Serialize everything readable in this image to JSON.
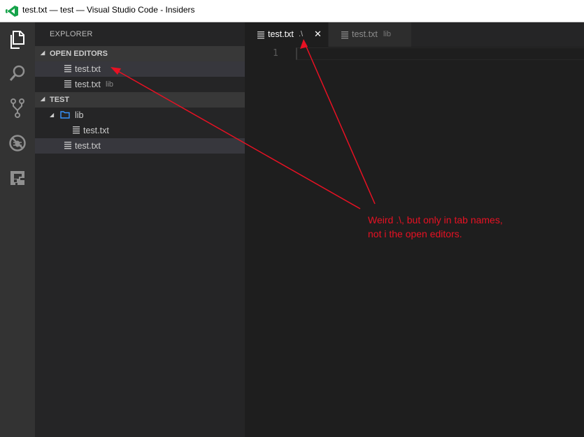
{
  "window": {
    "title": "test.txt — test — Visual Studio Code - Insiders"
  },
  "activity_bar": {
    "items": [
      {
        "name": "explorer",
        "icon": "files-icon",
        "active": true
      },
      {
        "name": "search",
        "icon": "search-icon",
        "active": false
      },
      {
        "name": "source-control",
        "icon": "git-branch-icon",
        "active": false
      },
      {
        "name": "debug",
        "icon": "debug-icon",
        "active": false
      },
      {
        "name": "extensions",
        "icon": "extensions-icon",
        "active": false
      }
    ]
  },
  "sidebar": {
    "title": "EXPLORER",
    "open_editors": {
      "header": "OPEN EDITORS",
      "items": [
        {
          "name": "test.txt",
          "desc": ""
        },
        {
          "name": "test.txt",
          "desc": "lib"
        }
      ]
    },
    "workspace": {
      "header": "TEST",
      "folder": "lib",
      "folder_child": "test.txt",
      "root_file": "test.txt"
    }
  },
  "tabs": [
    {
      "name": "test.txt",
      "desc": ".\\",
      "active": true
    },
    {
      "name": "test.txt",
      "desc": "lib",
      "active": false
    }
  ],
  "editor": {
    "line_numbers": [
      "1"
    ]
  },
  "annotation": {
    "text": "Weird .\\, but only in tab names,\nnot i the open editors.",
    "color": "#e81123"
  },
  "colors": {
    "activity_bar": "#333333",
    "sidebar": "#252526",
    "editor": "#1e1e1e",
    "selection": "#37373d",
    "folder_icon": "#3794ff",
    "logo": "#16a34a"
  }
}
